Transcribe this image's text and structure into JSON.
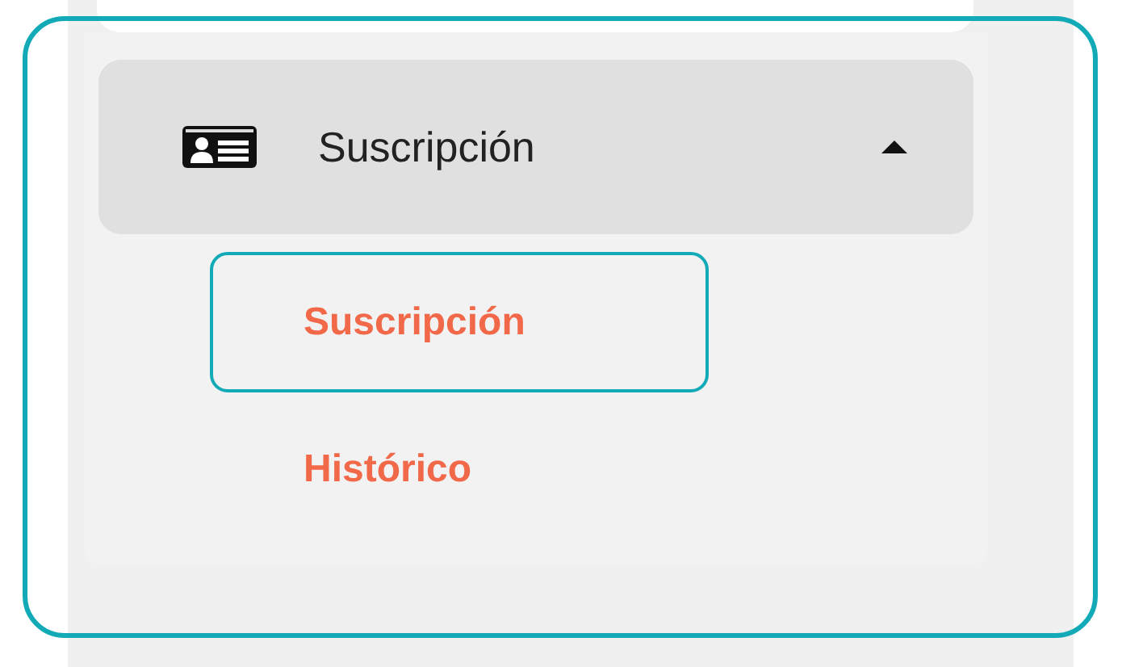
{
  "menu": {
    "label": "Suscripción",
    "expanded": true,
    "items": [
      {
        "label": "Suscripción",
        "selected": true
      },
      {
        "label": "Histórico",
        "selected": false
      }
    ]
  }
}
